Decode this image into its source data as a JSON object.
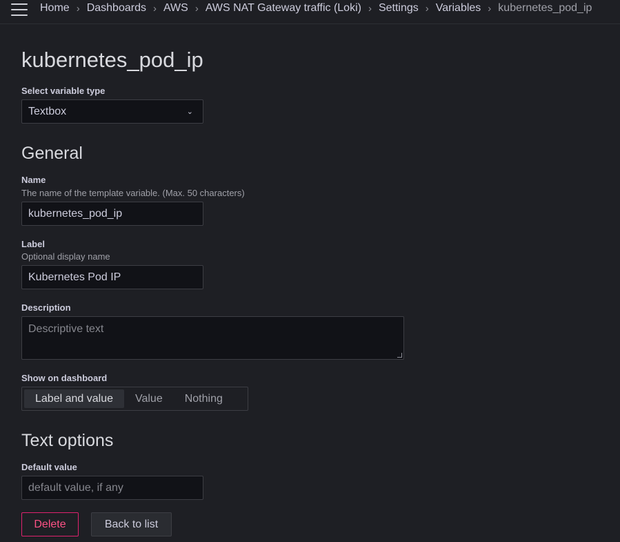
{
  "breadcrumbs": [
    "Home",
    "Dashboards",
    "AWS",
    "AWS NAT Gateway traffic (Loki)",
    "Settings",
    "Variables",
    "kubernetes_pod_ip"
  ],
  "page": {
    "title": "kubernetes_pod_ip"
  },
  "variable_type": {
    "label": "Select variable type",
    "value": "Textbox"
  },
  "general": {
    "heading": "General",
    "name": {
      "label": "Name",
      "description": "The name of the template variable. (Max. 50 characters)",
      "value": "kubernetes_pod_ip"
    },
    "display_label": {
      "label": "Label",
      "description": "Optional display name",
      "value": "Kubernetes Pod IP"
    },
    "description": {
      "label": "Description",
      "placeholder": "Descriptive text"
    },
    "show_on_dashboard": {
      "label": "Show on dashboard",
      "options": [
        "Label and value",
        "Value",
        "Nothing"
      ],
      "selected": "Label and value"
    }
  },
  "text_options": {
    "heading": "Text options",
    "default_value": {
      "label": "Default value",
      "placeholder": "default value, if any"
    }
  },
  "actions": {
    "delete_label": "Delete",
    "back_label": "Back to list"
  },
  "colors": {
    "background": "#1e1f24",
    "input_background": "#111217",
    "danger": "#ff5286"
  }
}
